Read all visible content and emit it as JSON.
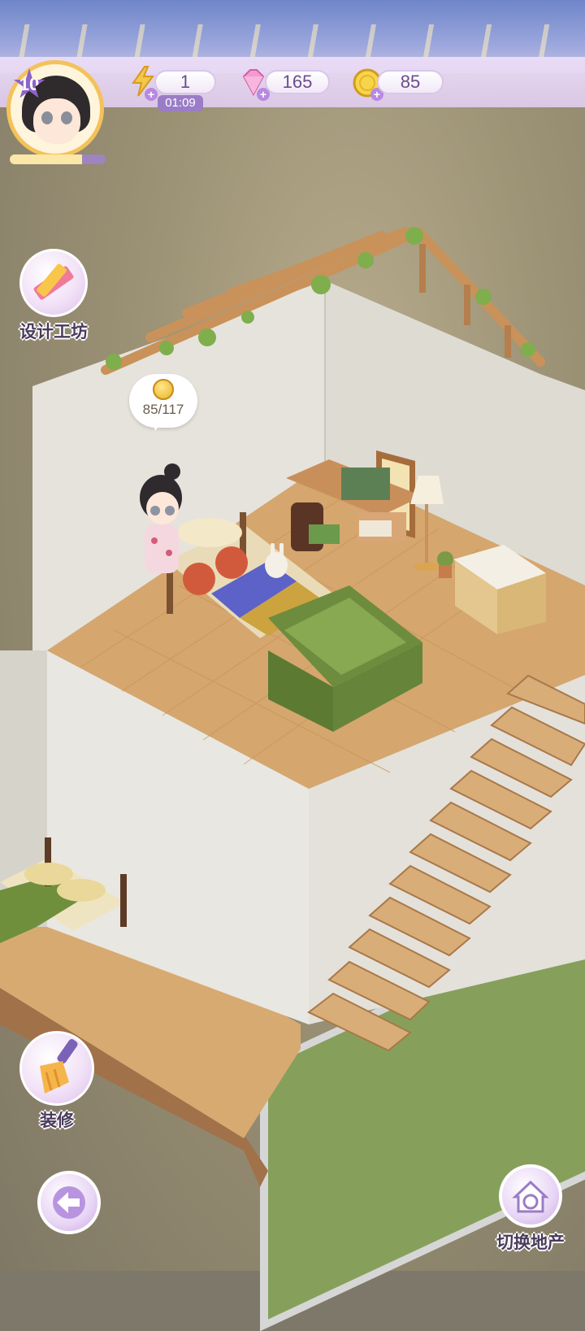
{
  "player": {
    "level": "10",
    "xp_progress": 0.75
  },
  "resources": {
    "energy": {
      "value": "1",
      "timer": "01:09",
      "icon": "lightning-icon"
    },
    "gems": {
      "value": "165",
      "icon": "diamond-icon"
    },
    "coins": {
      "value": "85",
      "icon": "coin-icon"
    }
  },
  "room": {
    "income_bubble": "85/117"
  },
  "buttons": {
    "design_workshop": "设计工坊",
    "decorate": "装修",
    "switch_property": "切换地产"
  },
  "colors": {
    "accent_purple": "#9b7cc6",
    "coin_gold": "#e9b22b",
    "floor_wood": "#d5a66e",
    "sofa_green": "#6e8c3d"
  }
}
